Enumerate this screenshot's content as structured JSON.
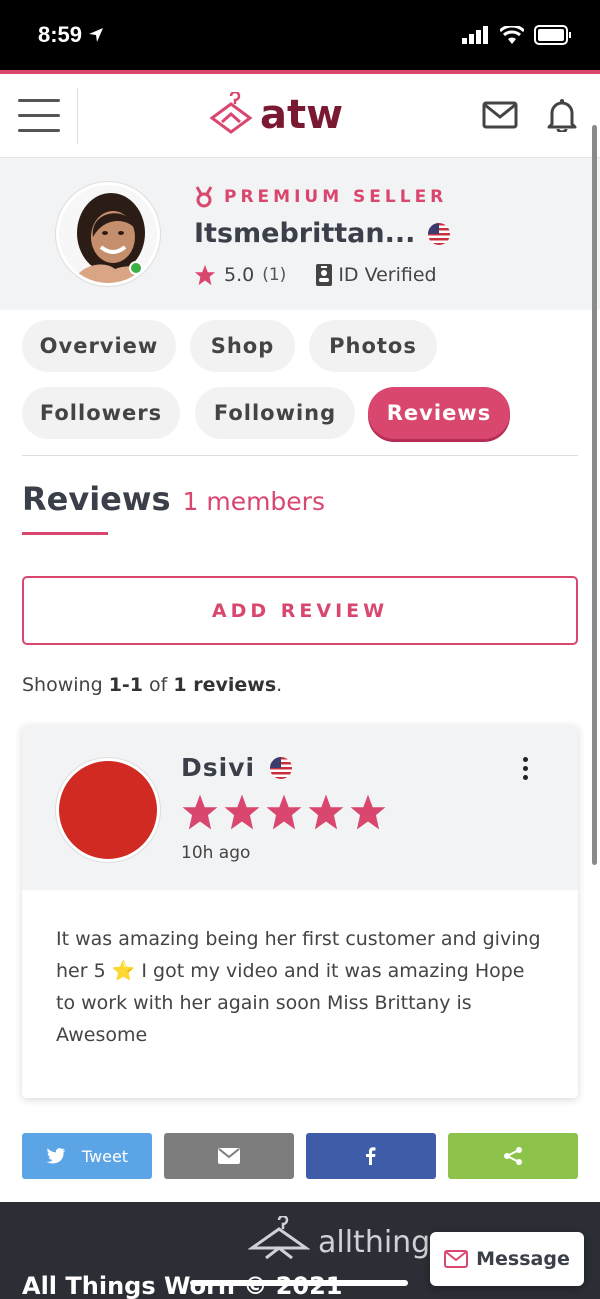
{
  "status_bar": {
    "time": "8:59"
  },
  "header": {
    "logo_text": "atw"
  },
  "profile": {
    "badge": "PREMIUM SELLER",
    "username": "Itsmebrittan...",
    "rating": "5.0",
    "rating_count": "(1)",
    "verified_label": "ID Verified"
  },
  "tabs": [
    "Overview",
    "Shop",
    "Photos",
    "Followers",
    "Following",
    "Reviews"
  ],
  "reviews_section": {
    "title": "Reviews",
    "count_label": "1 members",
    "add_review_label": "ADD REVIEW",
    "showing_prefix": "Showing ",
    "showing_range": "1-1",
    "showing_mid": " of ",
    "showing_total": "1 reviews",
    "showing_suffix": "."
  },
  "review": {
    "reviewer": "Dsivi",
    "stars": 5,
    "time": "10h ago",
    "text": "It was amazing being her first customer and giving her 5 ⭐️ I got my video and it was amazing Hope to work with her again soon Miss Brittany is Awesome"
  },
  "share": {
    "tweet_label": "Tweet"
  },
  "footer": {
    "logo_text": "allthing",
    "copyright": "All Things Worn © 2021",
    "message_label": "Message"
  },
  "colors": {
    "accent": "#d9476f",
    "twitter": "#5ba4e5",
    "email": "#7d7d7d",
    "facebook": "#3f5ca8",
    "share": "#8dc34a"
  }
}
